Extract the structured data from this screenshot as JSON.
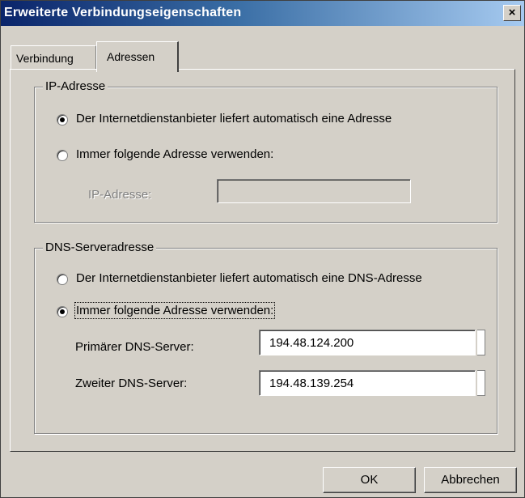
{
  "window": {
    "title": "Erweiterte Verbindungseigenschaften",
    "close_glyph": "×"
  },
  "tabs": [
    {
      "label": "Verbindung"
    },
    {
      "label": "Adressen"
    }
  ],
  "ip_group": {
    "legend": "IP-Adresse",
    "options": [
      {
        "label": "Der Internetdienstanbieter liefert automatisch eine Adresse",
        "checked": true
      },
      {
        "label": "Immer folgende Adresse verwenden:",
        "checked": false
      }
    ],
    "ip_field_label": "IP-Adresse:",
    "ip_field_value": ""
  },
  "dns_group": {
    "legend": "DNS-Serveradresse",
    "options": [
      {
        "label": "Der Internetdienstanbieter liefert automatisch eine DNS-Adresse",
        "checked": false
      },
      {
        "label": "Immer folgende Adresse verwenden:",
        "checked": true
      }
    ],
    "primary_label": "Primärer DNS-Server:",
    "primary_value": "194.48.124.200",
    "secondary_label": "Zweiter DNS-Server:",
    "secondary_value": "194.48.139.254"
  },
  "buttons": {
    "ok": "OK",
    "cancel": "Abbrechen"
  }
}
